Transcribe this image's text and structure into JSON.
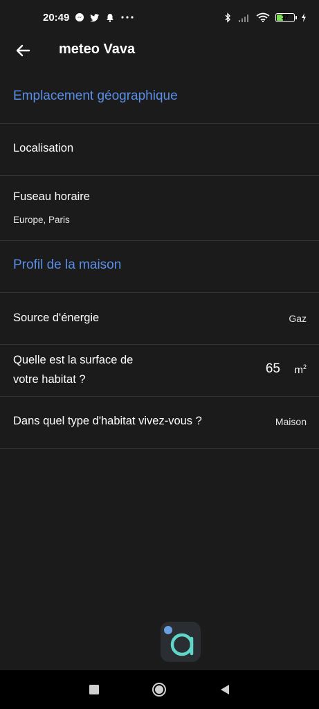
{
  "status_bar": {
    "time": "20:49",
    "battery_level": "37",
    "battery_fraction": 0.37,
    "icons": [
      "messenger-icon",
      "twitter-icon",
      "bell-icon",
      "more-icon",
      "bluetooth-icon",
      "signal-icon",
      "wifi-icon",
      "battery-icon",
      "charging-icon"
    ]
  },
  "header": {
    "title": "meteo Vava",
    "back_icon": "arrow-left-icon"
  },
  "sections": {
    "location": {
      "title": "Emplacement géographique",
      "localisation_label": "Localisation",
      "timezone_label": "Fuseau horaire",
      "timezone_value": "Europe, Paris"
    },
    "home_profile": {
      "title": "Profil de la maison",
      "energy_label": "Source d'énergie",
      "energy_value": "Gaz",
      "surface_label_line1": "Quelle est la surface de",
      "surface_label_line2": "votre habitat ?",
      "surface_value": "65",
      "surface_unit": "m",
      "surface_unit_exp": "2",
      "housing_label": "Dans quel type d'habitat vivez-vous ?",
      "housing_value": "Maison"
    }
  },
  "colors": {
    "background": "#1b1b1b",
    "accent": "#5b8fe6",
    "divider": "#333333",
    "logo_teal": "#5fd6c8",
    "logo_blue": "#6a9fe0"
  },
  "nav_bar": {
    "buttons": [
      "recents-square-icon",
      "home-circle-icon",
      "back-triangle-icon"
    ]
  }
}
